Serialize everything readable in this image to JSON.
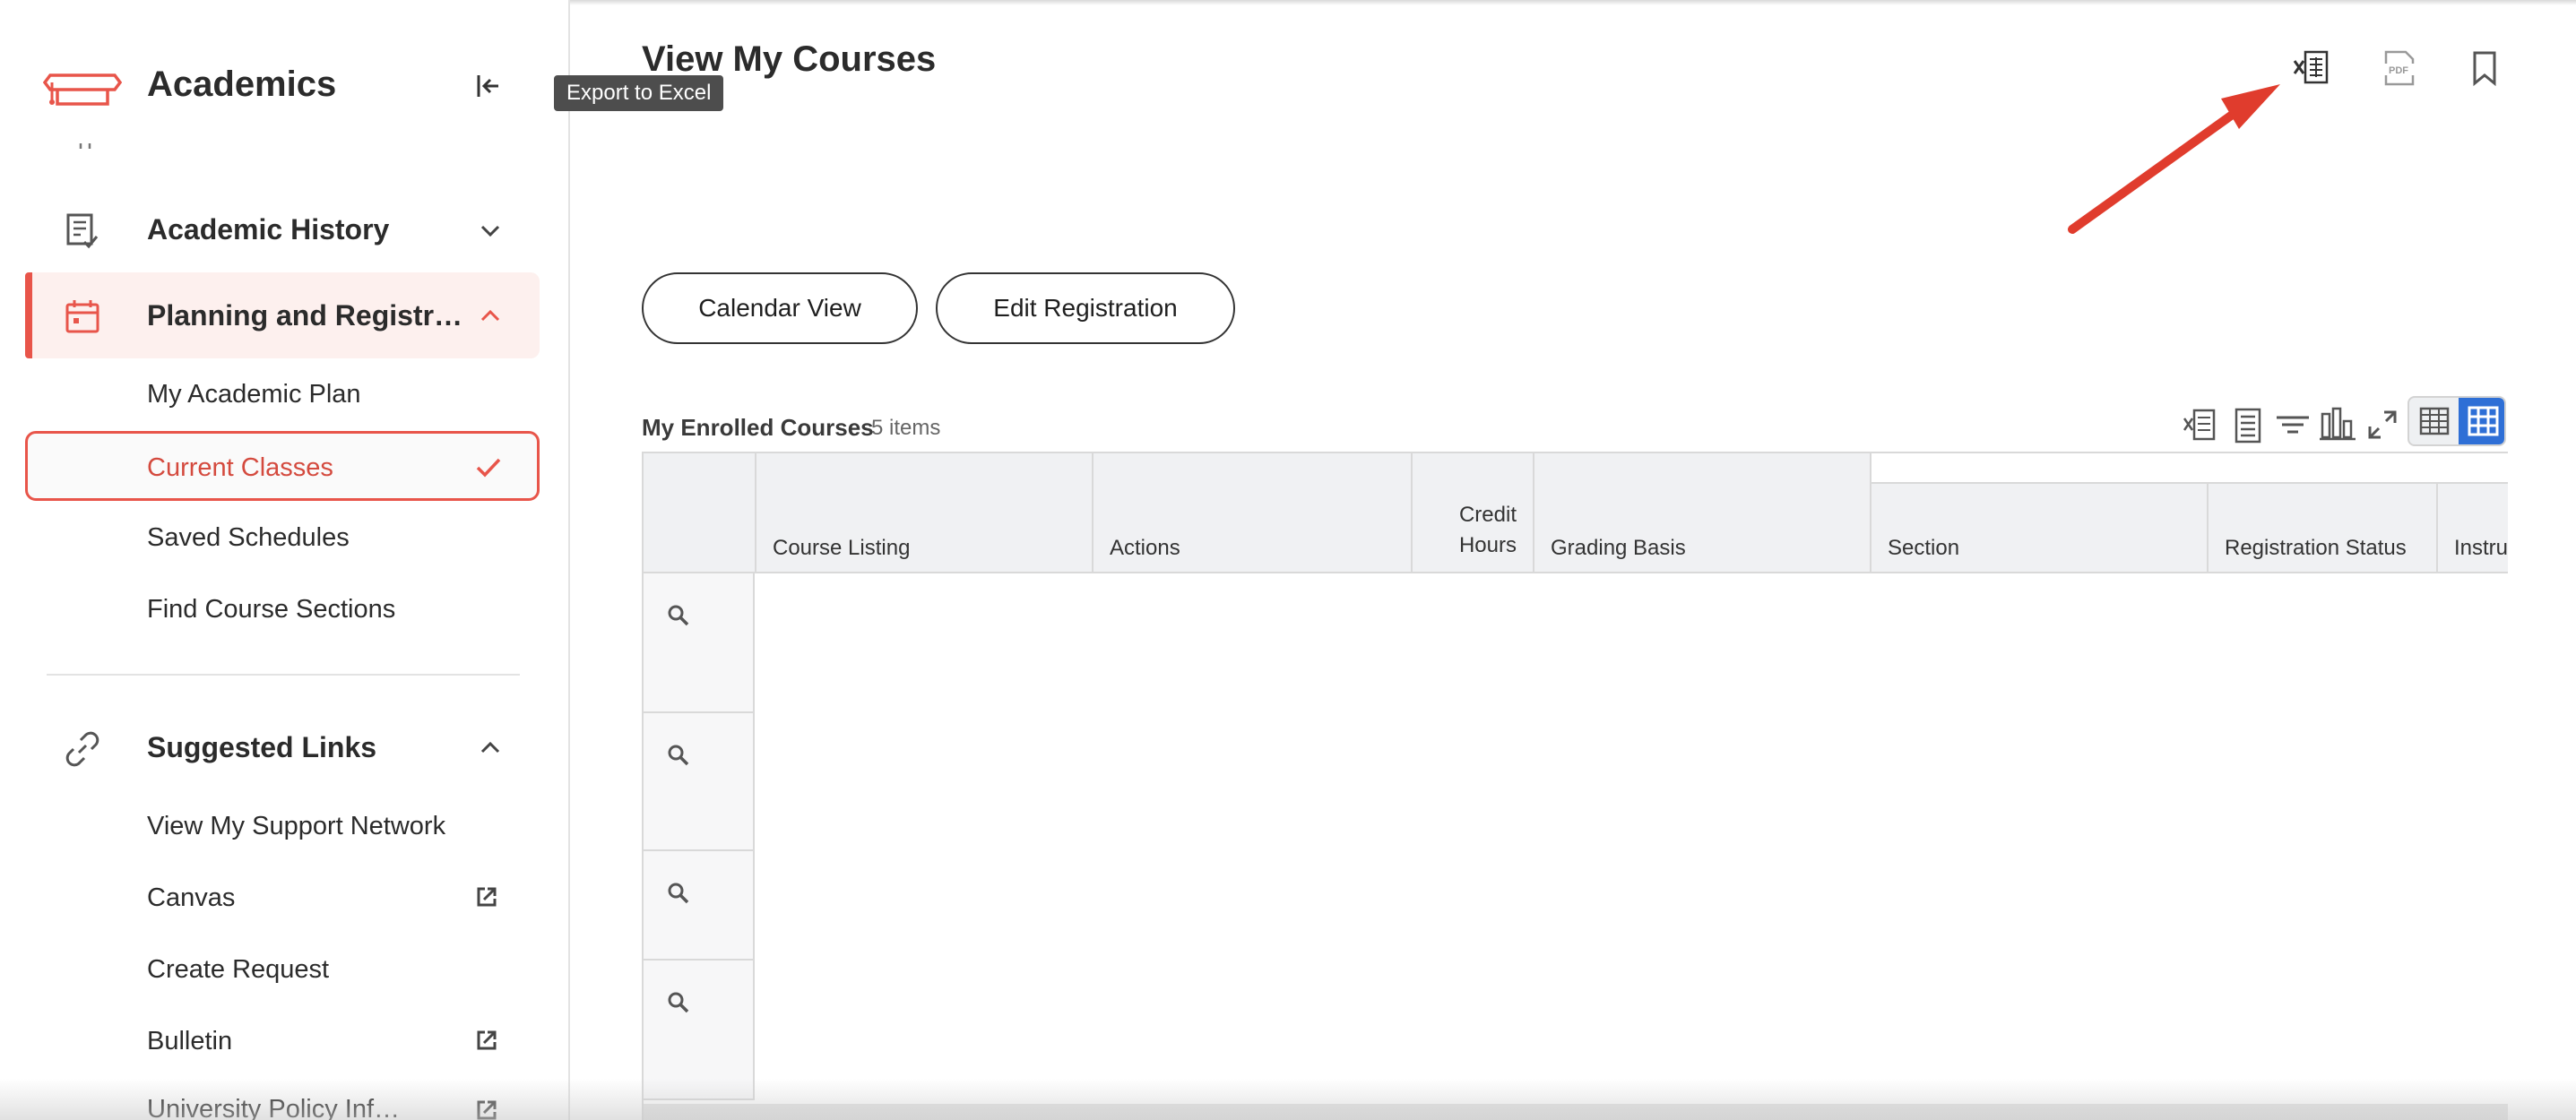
{
  "sidebar": {
    "title": "Academics",
    "nav": [
      {
        "label": "Academic History",
        "icon": "document-check-icon",
        "expanded": false
      },
      {
        "label": "Planning and Registr…",
        "icon": "calendar-icon",
        "expanded": true
      }
    ],
    "planning_items": [
      {
        "label": "My Academic Plan"
      },
      {
        "label": "Current Classes",
        "selected": true
      },
      {
        "label": "Saved Schedules"
      },
      {
        "label": "Find Course Sections"
      }
    ],
    "suggested": {
      "label": "Suggested Links",
      "icon": "link-icon",
      "items": [
        {
          "label": "View My Support Network",
          "external": false
        },
        {
          "label": "Canvas",
          "external": true
        },
        {
          "label": "Create Request",
          "external": false
        },
        {
          "label": "Bulletin",
          "external": true
        },
        {
          "label": "University Policy Inf…",
          "external": true
        }
      ]
    }
  },
  "header": {
    "title": "View My Courses",
    "tooltip": "Export to Excel",
    "icons": [
      "excel-export-icon",
      "pdf-export-icon",
      "bookmark-icon"
    ]
  },
  "actions": {
    "calendar_view": "Calendar View",
    "edit_registration": "Edit Registration"
  },
  "grid": {
    "title": "My Enrolled Courses",
    "count": "5 items",
    "columns": [
      "Course Listing",
      "Actions",
      "Credit Hours",
      "Grading Basis",
      "Section",
      "Registration Status",
      "Instru"
    ],
    "tools": [
      "excel-icon",
      "list-view-icon",
      "filter-icon",
      "chart-icon",
      "fullscreen-icon"
    ]
  },
  "colors": {
    "accent": "#e8554a",
    "active_bg": "#fdf0ee",
    "toggle_blue": "#2e6fd6",
    "annotation_arrow": "#e03c2d"
  }
}
